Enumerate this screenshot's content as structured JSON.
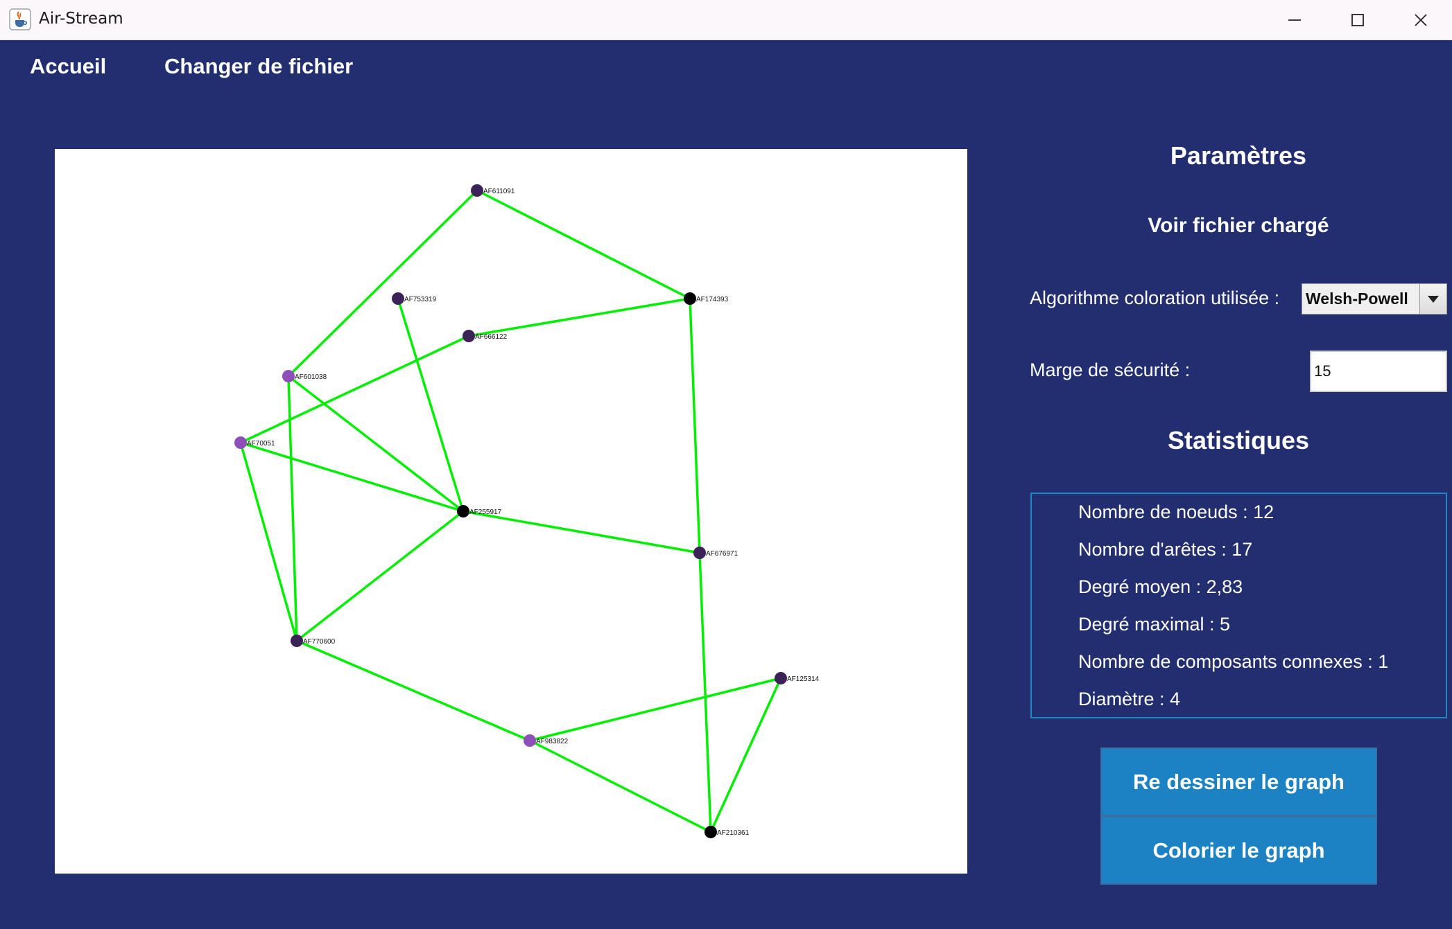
{
  "window": {
    "title": "Air-Stream",
    "icons": {
      "app": "java-cup-icon",
      "minimize": "minimize-icon",
      "maximize": "maximize-icon",
      "close": "close-icon"
    }
  },
  "menu": {
    "home": "Accueil",
    "change_file": "Changer de fichier"
  },
  "params": {
    "title": "Paramètres",
    "view_file": "Voir fichier chargé",
    "algo_label": "Algorithme coloration utilisée :",
    "algo_value": "Welsh-Powell",
    "margin_label": "Marge de sécurité :",
    "margin_value": "15"
  },
  "stats": {
    "title": "Statistiques",
    "lines": [
      "Nombre de noeuds : 12",
      "Nombre d'arêtes : 17",
      "Degré moyen : 2,83",
      "Degré maximal : 5",
      "Nombre de composants connexes : 1",
      "Diamètre : 4"
    ]
  },
  "buttons": {
    "redraw": "Re dessiner le graph",
    "color": "Colorier le graph"
  },
  "colors": {
    "background": "#222e70",
    "edge": "#00ee00",
    "node_black": "#000000",
    "node_dark_purple": "#3b2257",
    "node_light_purple": "#8e4fb8",
    "button": "#1c82c3"
  },
  "graph": {
    "nodes": [
      {
        "id": "AF611091",
        "color": "dark"
      },
      {
        "id": "AF753319",
        "color": "dark"
      },
      {
        "id": "AF174393",
        "color": "black"
      },
      {
        "id": "AF666122",
        "color": "dark"
      },
      {
        "id": "AF601038",
        "color": "light"
      },
      {
        "id": "AF70051",
        "color": "light"
      },
      {
        "id": "AF255917",
        "color": "black"
      },
      {
        "id": "AF676971",
        "color": "dark"
      },
      {
        "id": "AF770600",
        "color": "dark"
      },
      {
        "id": "AF125314",
        "color": "dark"
      },
      {
        "id": "AF983822",
        "color": "light"
      },
      {
        "id": "AF210361",
        "color": "black"
      }
    ],
    "edges": [
      [
        "AF611091",
        "AF174393"
      ],
      [
        "AF611091",
        "AF601038"
      ],
      [
        "AF174393",
        "AF666122"
      ],
      [
        "AF174393",
        "AF676971"
      ],
      [
        "AF753319",
        "AF255917"
      ],
      [
        "AF666122",
        "AF70051"
      ],
      [
        "AF601038",
        "AF255917"
      ],
      [
        "AF601038",
        "AF770600"
      ],
      [
        "AF70051",
        "AF255917"
      ],
      [
        "AF70051",
        "AF770600"
      ],
      [
        "AF255917",
        "AF676971"
      ],
      [
        "AF255917",
        "AF770600"
      ],
      [
        "AF676971",
        "AF210361"
      ],
      [
        "AF770600",
        "AF983822"
      ],
      [
        "AF983822",
        "AF125314"
      ],
      [
        "AF983822",
        "AF210361"
      ],
      [
        "AF125314",
        "AF210361"
      ]
    ]
  }
}
